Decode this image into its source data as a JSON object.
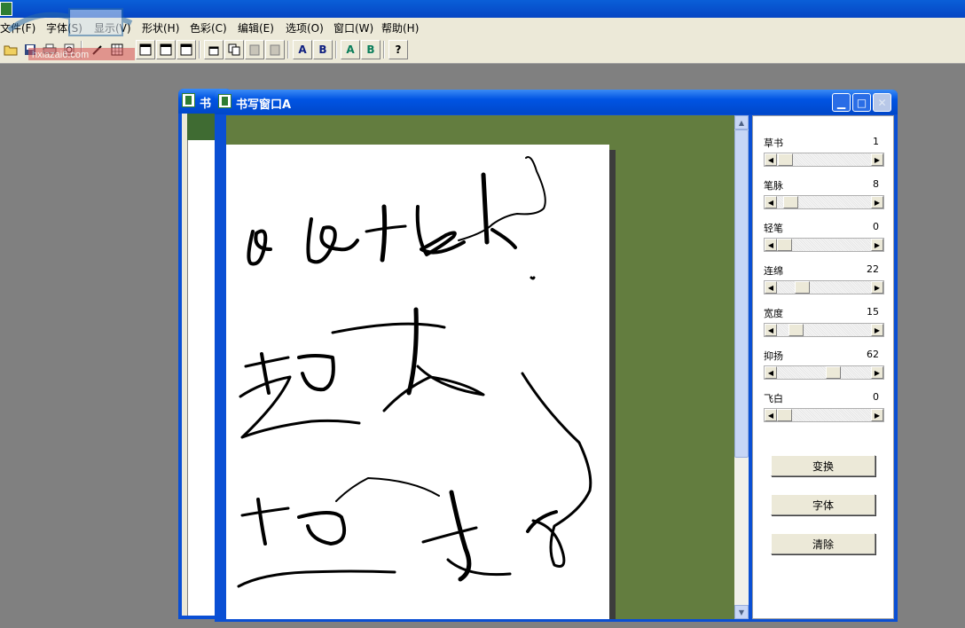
{
  "menu": [
    "文件(F)",
    "字体(S)",
    "显示(V)",
    "形状(H)",
    "色彩(C)",
    "编辑(E)",
    "选项(O)",
    "窗口(W)",
    "帮助(H)"
  ],
  "watermark": "hxiazai6.com",
  "toolbar": {
    "a_label": "A",
    "b_label": "B",
    "a2_label": "A",
    "b2_label": "B",
    "help_label": "?"
  },
  "back_window": {
    "title": "书"
  },
  "window": {
    "title": "书写窗口A"
  },
  "sliders": [
    {
      "label": "草书",
      "value": 1,
      "max": 100
    },
    {
      "label": "笔脉",
      "value": 8,
      "max": 100
    },
    {
      "label": "轻笔",
      "value": 0,
      "max": 100
    },
    {
      "label": "连绵",
      "value": 22,
      "max": 100
    },
    {
      "label": "宽度",
      "value": 15,
      "max": 100
    },
    {
      "label": "抑扬",
      "value": 62,
      "max": 100
    },
    {
      "label": "飞白",
      "value": 0,
      "max": 100
    }
  ],
  "buttons": {
    "transform": "变换",
    "font": "字体",
    "clear": "清除"
  },
  "colors": {
    "canvas_bg": "#637d3f",
    "titlebar": "#0a5fd8",
    "window_frame": "#0a4fd4"
  },
  "icons": [
    "open-icon",
    "save-icon",
    "print-icon",
    "preview-icon",
    "brush-icon",
    "grid-icon",
    "window-icon",
    "copy-icon",
    "paste-icon",
    "help-icon"
  ]
}
